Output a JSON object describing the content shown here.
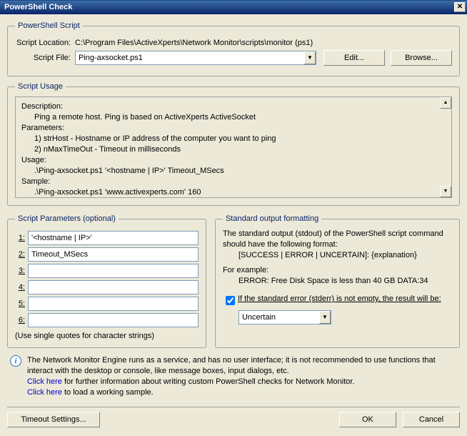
{
  "window": {
    "title": "PowerShell Check"
  },
  "scriptGroup": {
    "legend": "PowerShell Script",
    "location_label": "Script Location:",
    "location_value": "C:\\Program Files\\ActiveXperts\\Network Monitor\\scripts\\monitor (ps1)",
    "file_label": "Script File:",
    "file_value": "Ping-axsocket.ps1",
    "edit_btn": "Edit...",
    "browse_btn": "Browse..."
  },
  "usageGroup": {
    "legend": "Script Usage",
    "description_label": "Description:",
    "description_text": "Ping a remote host. Ping is based on ActiveXperts ActiveSocket",
    "parameters_label": "Parameters:",
    "param1": "1) strHost   - Hostname or IP address of the computer you want to ping",
    "param2": "2) nMaxTimeOut - Timeout in milliseconds",
    "usage_label": "Usage:",
    "usage_text": ".\\Ping-axsocket.ps1 '<hostname | IP>' Timeout_MSecs",
    "sample_label": "Sample:",
    "sample_text": ".\\Ping-axsocket.ps1 'www.activexperts.com' 160"
  },
  "paramsGroup": {
    "legend": "Script Parameters (optional)",
    "labels": [
      "1:",
      "2:",
      "3:",
      "4:",
      "5:",
      "6:"
    ],
    "values": [
      "'<hostname | IP>'",
      "Timeout_MSecs",
      "",
      "",
      "",
      ""
    ],
    "note": "(Use single quotes for character strings)"
  },
  "stdGroup": {
    "legend": "Standard output formatting",
    "line1": "The standard output (stdout) of the PowerShell script command should have the following format:",
    "format_line": "[SUCCESS | ERROR | UNCERTAIN]: {explanation}",
    "example_label": "For example:",
    "example_text": "ERROR: Free Disk Space is less than 40 GB DATA:34",
    "stderr_label": "If the standard error (stderr) is not empty, the result will be:",
    "stderr_checked": true,
    "uncertain_value": "Uncertain"
  },
  "info": {
    "line1": "The Network Monitor Engine runs as a service, and has no user interface; it is not recommended to use functions that interact with the desktop or console, like message boxes, input dialogs, etc.",
    "link1_text": "Click here",
    "link1_rest": " for further information about writing custom PowerShell checks for Network Monitor.",
    "link2_text": "Click here",
    "link2_rest": " to load a working sample."
  },
  "footer": {
    "timeout_btn": "Timeout Settings...",
    "ok_btn": "OK",
    "cancel_btn": "Cancel"
  }
}
